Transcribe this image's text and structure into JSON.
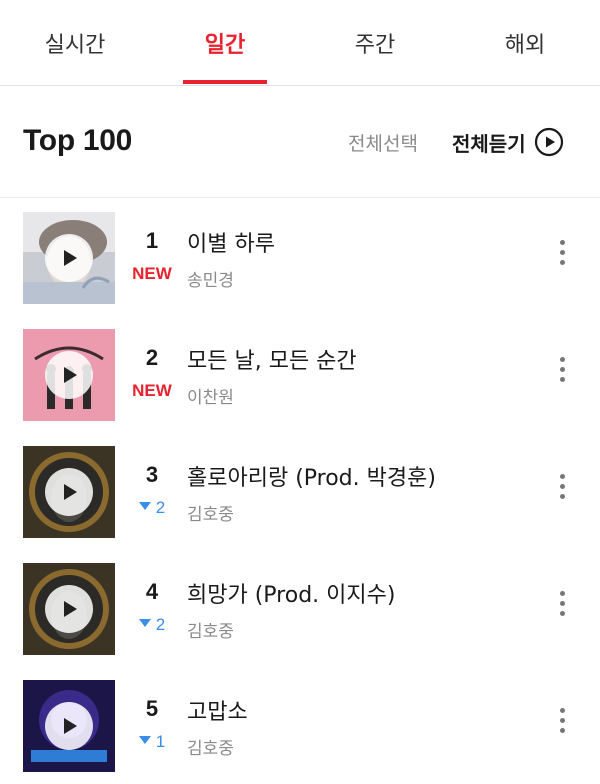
{
  "tabs": [
    {
      "label": "실시간",
      "active": false
    },
    {
      "label": "일간",
      "active": true
    },
    {
      "label": "주간",
      "active": false
    },
    {
      "label": "해외",
      "active": false
    }
  ],
  "header": {
    "title": "Top 100",
    "select_all": "전체선택",
    "listen_all": "전체듣기",
    "listen_icon": "play-circle-icon"
  },
  "colors": {
    "accent": "#e8232f",
    "down": "#3a8ee6",
    "muted": "#8a8a8a"
  },
  "songs": [
    {
      "rank": "1",
      "change": "NEW",
      "change_type": "new",
      "title": "이별 하루",
      "artist": "송민경",
      "cover": "cover-1"
    },
    {
      "rank": "2",
      "change": "NEW",
      "change_type": "new",
      "title": "모든 날, 모든 순간",
      "artist": "이찬원",
      "cover": "cover-2"
    },
    {
      "rank": "3",
      "change": "2",
      "change_type": "down",
      "title": "홀로아리랑 (Prod. 박경훈)",
      "artist": "김호중",
      "cover": "cover-3"
    },
    {
      "rank": "4",
      "change": "2",
      "change_type": "down",
      "title": "희망가 (Prod. 이지수)",
      "artist": "김호중",
      "cover": "cover-4"
    },
    {
      "rank": "5",
      "change": "1",
      "change_type": "down",
      "title": "고맙소",
      "artist": "김호중",
      "cover": "cover-5"
    }
  ]
}
